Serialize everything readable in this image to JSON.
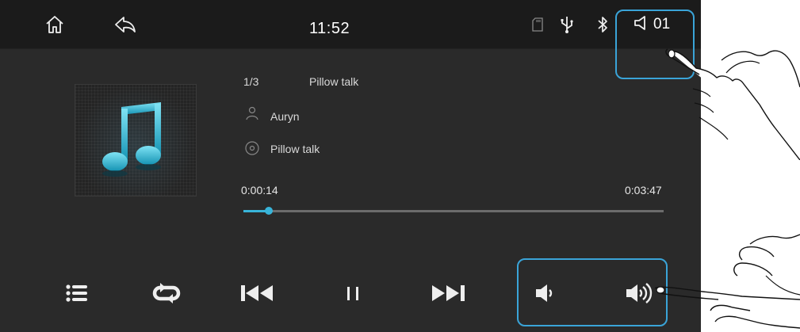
{
  "status_bar": {
    "time": "11:52",
    "volume_level": "01",
    "icons": [
      "home-icon",
      "back-icon",
      "sd-card-icon",
      "usb-icon",
      "bluetooth-icon",
      "speaker-icon"
    ]
  },
  "track": {
    "index": "1/3",
    "title": "Pillow talk",
    "artist": "Auryn",
    "album": "Pillow talk",
    "elapsed": "0:00:14",
    "duration": "0:03:47",
    "progress_fraction": 0.06
  },
  "controls": [
    "playlist-icon",
    "repeat-icon",
    "previous-icon",
    "pause-icon",
    "next-icon",
    "volume-down-icon",
    "volume-up-icon"
  ],
  "colors": {
    "accent": "#38b4d9",
    "highlight": "#3aa4d8",
    "background": "#2a2a2a",
    "status_bar": "#1b1b1b"
  }
}
